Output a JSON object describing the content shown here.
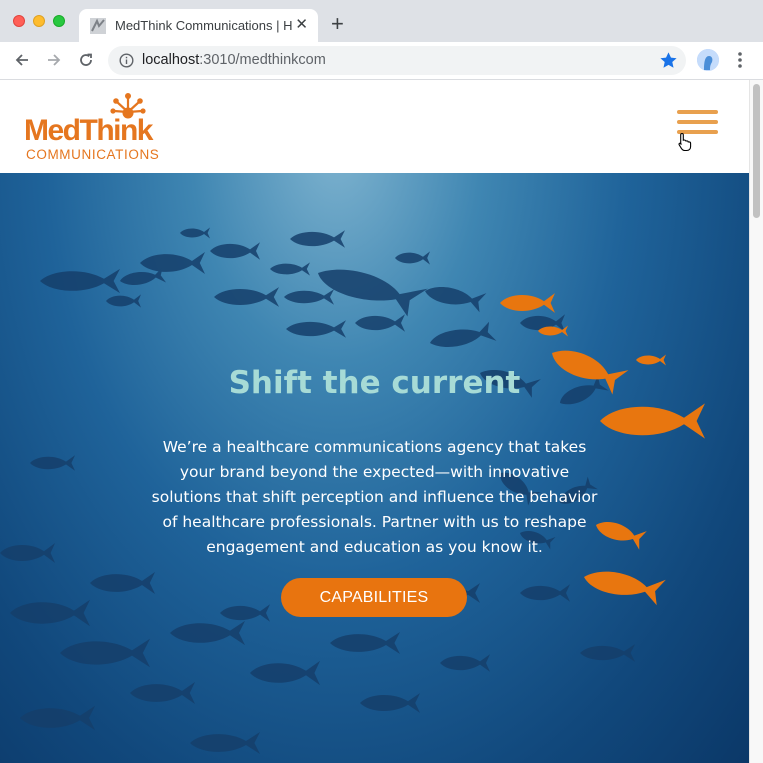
{
  "browser": {
    "tab_title": "MedThink Communications | H",
    "tab_close": "✕",
    "new_tab": "+",
    "url_host": "localhost",
    "url_path": ":3010/medthinkcom"
  },
  "site": {
    "logo": {
      "name": "MedThink",
      "subtitle": "COMMUNICATIONS"
    },
    "hero": {
      "title": "Shift the current",
      "body": "We’re a healthcare communications agency that takes your brand beyond the expected—with innovative solutions that shift perception and influence the behavior of healthcare professionals. Partner with us to reshape engagement and education as you know it.",
      "cta_label": "CAPABILITIES"
    }
  },
  "colors": {
    "brand_orange": "#e5761f",
    "hero_title": "#a7dbd6",
    "cta_bg": "#e8740f",
    "hero_blue": "#1f639a"
  },
  "icons": [
    "back-arrow-icon",
    "forward-arrow-icon",
    "reload-icon",
    "info-icon",
    "bookmark-star-icon",
    "profile-avatar-icon",
    "menu-kebab-icon",
    "hamburger-menu-icon",
    "hand-cursor-icon"
  ]
}
